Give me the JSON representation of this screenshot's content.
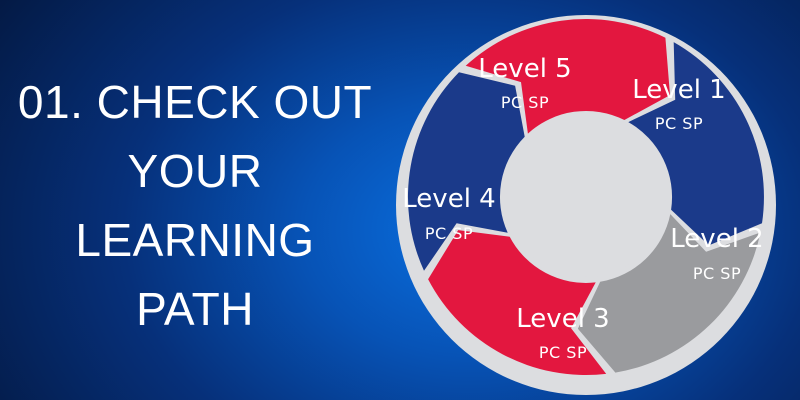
{
  "heading": {
    "lines": [
      "01. CHECK OUT",
      "YOUR",
      "LEARNING",
      "PATH"
    ]
  },
  "cycle": {
    "segments": [
      {
        "level": "Level 1",
        "label": "PC SP",
        "color": "#1b3a8a"
      },
      {
        "level": "Level 2",
        "label": "PC SP",
        "color": "#9a9b9e"
      },
      {
        "level": "Level 3",
        "label": "PC SP",
        "color": "#e3173f"
      },
      {
        "level": "Level 4",
        "label": "PC SP",
        "color": "#1b3a8a"
      },
      {
        "level": "Level 5",
        "label": "PC SP",
        "color": "#e3173f"
      }
    ],
    "ring_color": "#dcdde0",
    "center_color": "#dcdde0"
  }
}
